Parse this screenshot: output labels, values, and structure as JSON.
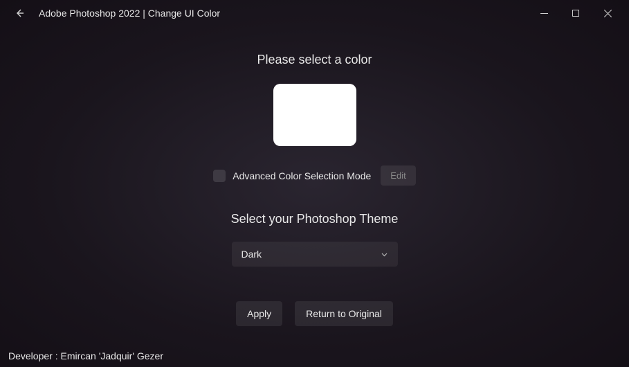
{
  "window": {
    "title": "Adobe Photoshop 2022 | Change UI Color"
  },
  "main": {
    "heading": "Please select a color",
    "swatch_color": "#ffffff",
    "advanced": {
      "label": "Advanced Color Selection Mode",
      "checked": false,
      "edit_label": "Edit"
    },
    "theme": {
      "heading": "Select your Photoshop Theme",
      "selected": "Dark"
    },
    "actions": {
      "apply": "Apply",
      "return": "Return to Original"
    }
  },
  "footer": {
    "developer": "Developer : Emircan 'Jadquir' Gezer"
  }
}
